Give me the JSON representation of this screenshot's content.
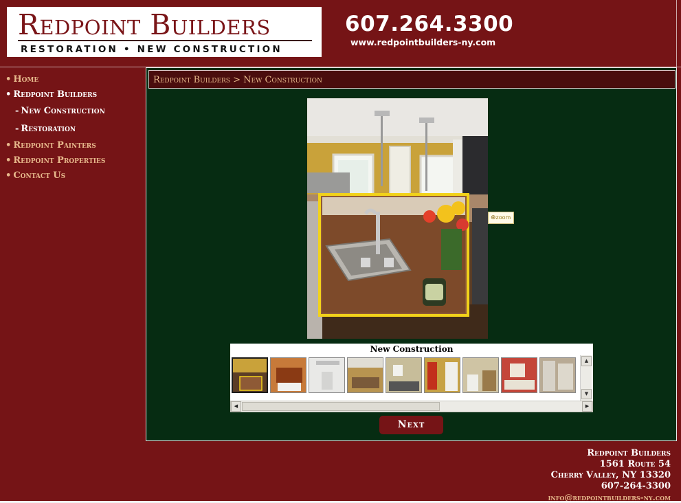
{
  "header": {
    "logo_name": "Redpoint Builders",
    "logo_tagline": "RESTORATION • NEW CONSTRUCTION",
    "phone": "607.264.3300",
    "website": "www.redpointbuilders-ny.com"
  },
  "nav": {
    "items": [
      {
        "label": "Home",
        "bullet": "•"
      },
      {
        "label": "Redpoint Builders",
        "bullet": "•"
      },
      {
        "label": "New Construction",
        "bullet": "-"
      },
      {
        "label": "Restoration",
        "bullet": "-"
      },
      {
        "label": "Redpoint Painters",
        "bullet": "•"
      },
      {
        "label": "Redpoint Properties",
        "bullet": "•"
      },
      {
        "label": "Contact Us",
        "bullet": "•"
      }
    ]
  },
  "breadcrumb": {
    "root": "Redpoint Builders",
    "separator": ">",
    "current": "New Construction"
  },
  "viewer": {
    "zoom_label": "zoom",
    "gallery_title": "New Construction",
    "next_label": "Next"
  },
  "footer": {
    "company": "Redpoint Builders",
    "address1": "1561 Route 54",
    "address2": "Cherry Valley, NY 13320",
    "phone": "607-264-3300",
    "email": "info@redpointbuilders-ny.com"
  },
  "colors": {
    "brand_red": "#751416",
    "panel_green": "#062c12",
    "accent_gold": "#e7b98c",
    "zoom_frame": "#f2d21a"
  }
}
